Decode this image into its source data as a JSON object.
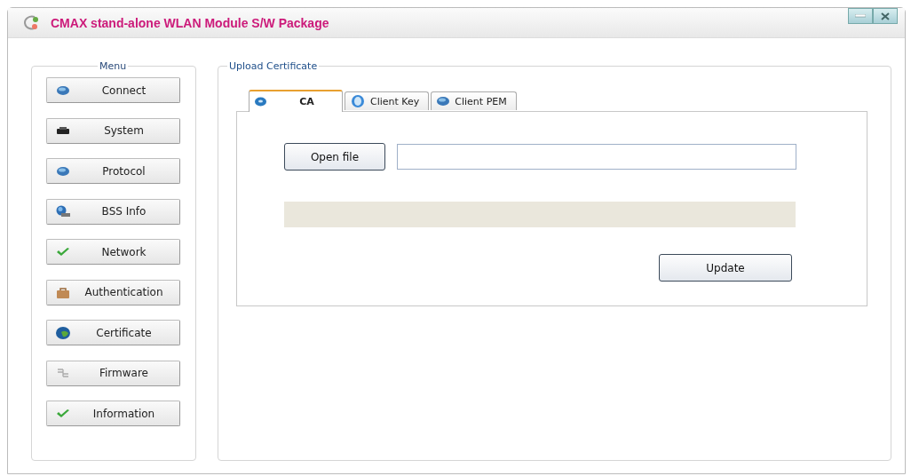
{
  "window": {
    "title": "CMAX stand-alone WLAN Module S/W Package"
  },
  "menu": {
    "title": "Menu",
    "items": [
      {
        "label": "Connect",
        "kind": "globe"
      },
      {
        "label": "System",
        "kind": "printer"
      },
      {
        "label": "Protocol",
        "kind": "globe"
      },
      {
        "label": "BSS Info",
        "kind": "network"
      },
      {
        "label": "Network",
        "kind": "check"
      },
      {
        "label": "Authentication",
        "kind": "lock"
      },
      {
        "label": "Certificate",
        "kind": "earth"
      },
      {
        "label": "Firmware",
        "kind": "plug"
      },
      {
        "label": "Information",
        "kind": "check"
      }
    ]
  },
  "upload": {
    "title": "Upload Certificate",
    "tabs": [
      {
        "label": "CA",
        "selected": true
      },
      {
        "label": "Client Key",
        "selected": false
      },
      {
        "label": "Client PEM",
        "selected": false
      }
    ],
    "open_button": "Open file",
    "update_button": "Update"
  }
}
